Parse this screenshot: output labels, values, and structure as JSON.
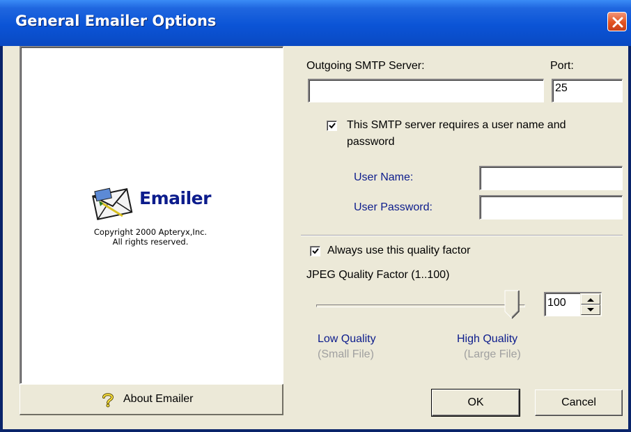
{
  "window": {
    "title": "General Emailer Options"
  },
  "left_panel": {
    "app_name": "Emailer",
    "copyright_line1": "Copyright 2000 Apteryx,Inc.",
    "copyright_line2": "All rights reserved.",
    "about_button": "About Emailer"
  },
  "smtp": {
    "server_label": "Outgoing SMTP Server:",
    "server_value": "",
    "port_label": "Port:",
    "port_value": "25",
    "auth_checkbox_line1": "This SMTP server requires a user name and",
    "auth_checkbox_line2": "password",
    "auth_checked": true,
    "username_label": "User Name:",
    "username_value": "",
    "password_label": "User Password:",
    "password_value": ""
  },
  "quality": {
    "always_use_label": "Always use this quality factor",
    "always_use_checked": true,
    "factor_label": "JPEG Quality Factor  (1..100)",
    "value": "100",
    "slider_fraction": 1.0,
    "low_label": "Low Quality",
    "low_sub": "(Small File)",
    "high_label": "High Quality",
    "high_sub": "(Large File)"
  },
  "buttons": {
    "ok": "OK",
    "cancel": "Cancel"
  },
  "colors": {
    "title_bar": "#0b54d6",
    "dialog_bg": "#ece9d8",
    "label_blue": "#0c1c8c",
    "close_red": "#e2521f"
  }
}
